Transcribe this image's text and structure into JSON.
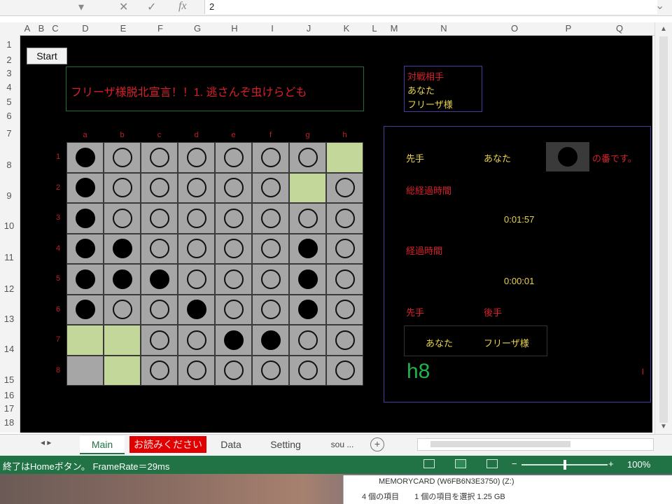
{
  "formula_bar": {
    "name_box_arrow": "▾",
    "cancel_icon": "✕",
    "enter_icon": "✓",
    "fx_label": "fx",
    "value": "2"
  },
  "columns": [
    "A",
    "B",
    "C",
    "D",
    "E",
    "F",
    "G",
    "H",
    "I",
    "J",
    "K",
    "L",
    "M",
    "N",
    "O",
    "P",
    "Q"
  ],
  "rows": [
    "1",
    "2",
    "3",
    "4",
    "5",
    "6",
    "7",
    "8",
    "9",
    "10",
    "11",
    "12",
    "13",
    "14",
    "15",
    "16",
    "17",
    "18"
  ],
  "start_button": "Start",
  "title": "フリーザ様脱北宣言！！1. 逃さんぞ虫けらども",
  "players": {
    "heading": "対戦相手",
    "player1": "あなた",
    "player2": "フリーザ様"
  },
  "board": {
    "col_letters": [
      "a",
      "b",
      "c",
      "d",
      "e",
      "f",
      "g",
      "h"
    ],
    "row_numbers": [
      "1",
      "2",
      "3",
      "4",
      "5",
      "6",
      "7",
      "8"
    ],
    "cells": [
      [
        "B",
        "E",
        "E",
        "E",
        "E",
        "E",
        "E",
        "H"
      ],
      [
        "B",
        "E",
        "E",
        "E",
        "E",
        "E",
        "H",
        "E"
      ],
      [
        "B",
        "E",
        "E",
        "E",
        "E",
        "E",
        "E",
        "E"
      ],
      [
        "B",
        "B",
        "E",
        "E",
        "E",
        "E",
        "B",
        "E"
      ],
      [
        "B",
        "B",
        "B",
        "E",
        "E",
        "E",
        "B",
        "E"
      ],
      [
        "B",
        "E",
        "E",
        "B",
        "E",
        "E",
        "B",
        "E"
      ],
      [
        "H",
        "H",
        "E",
        "E",
        "B",
        "B",
        "E",
        "E"
      ],
      [
        "G",
        "H",
        "E",
        "E",
        "E",
        "E",
        "E",
        "E"
      ]
    ]
  },
  "info": {
    "first_label": "先手",
    "first_player": "あなた",
    "turn_suffix": "の番です。",
    "total_time_label": "総経過時間",
    "total_time": "0:01:57",
    "elapsed_label": "経過時間",
    "elapsed_time": "0:00:01",
    "sente_label": "先手",
    "gote_label": "後手",
    "sente_player": "あなた",
    "gote_player": "フリーザ様",
    "last_move": "h8",
    "marker": "l"
  },
  "tabs": {
    "nav": "◂   ▸",
    "items": [
      "Main",
      "お読みください",
      "Data",
      "Setting",
      "sou ..."
    ],
    "add": "+"
  },
  "status": {
    "text": "終了はHomeボタン。 FrameRate＝29ms",
    "zoom_minus": "−",
    "zoom_plus": "+",
    "zoom": "100%",
    "zoom_level": 0.5
  },
  "explorer": {
    "line1": "MEMORYCARD (W6FB6N3E3750) (Z:)",
    "line2": "4 個の項目　　1 個の項目を選択  1.25 GB"
  },
  "colors": {
    "sheet_bg": "#000000",
    "board_cell": "#a6a6a6",
    "hint_cell": "#c4d79b",
    "title_red": "#d8202a",
    "text_yellow": "#e9d44a",
    "move_green": "#22b24c",
    "status_green": "#217346"
  }
}
